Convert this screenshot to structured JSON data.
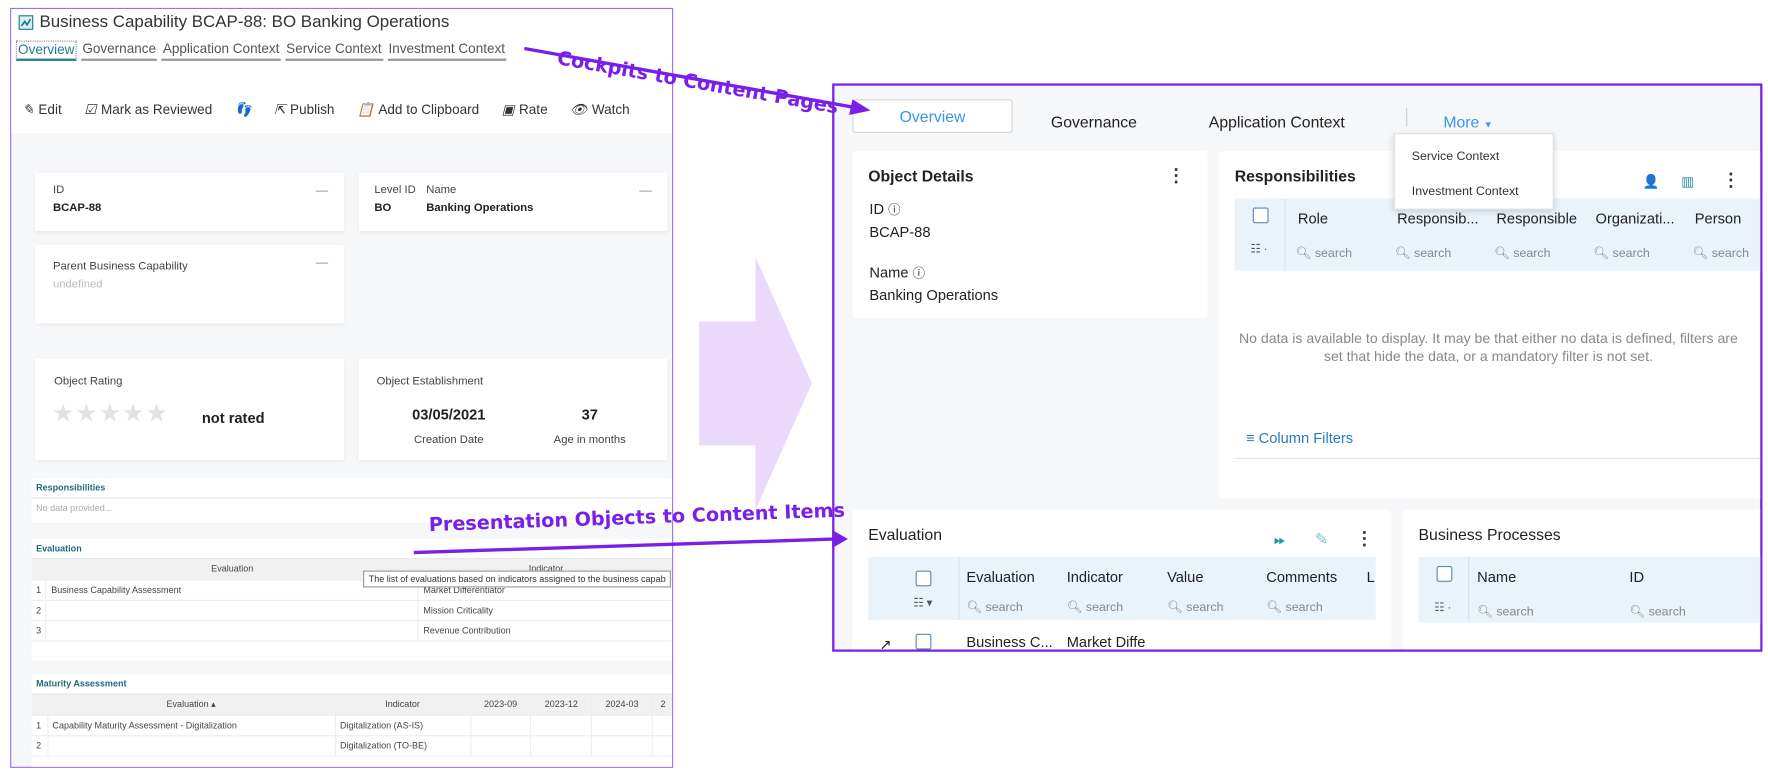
{
  "left": {
    "title": "Business Capability BCAP-88: BO Banking Operations",
    "tabs": [
      "Overview",
      "Governance",
      "Application Context",
      "Service Context",
      "Investment Context"
    ],
    "toolbar": {
      "edit": "Edit",
      "review": "Mark as Reviewed",
      "publish": "Publish",
      "clipboard": "Add to Clipboard",
      "rate": "Rate",
      "watch": "Watch"
    },
    "id_label": "ID",
    "id_value": "BCAP-88",
    "level_label": "Level ID",
    "level_value": "BO",
    "name_label": "Name",
    "name_value": "Banking Operations",
    "parent_label": "Parent Business Capability",
    "parent_value": "undefined",
    "rating_label": "Object Rating",
    "rating_value": "not rated",
    "rating_stars": 0,
    "establishment_label": "Object Establishment",
    "creation_date": "03/05/2021",
    "creation_label": "Creation Date",
    "age": "37",
    "age_label": "Age in months",
    "resp_title": "Responsibilities",
    "resp_empty": "No data provided...",
    "eval_title": "Evaluation",
    "eval_headers": [
      "Evaluation",
      "Indicator"
    ],
    "eval_rows": [
      [
        "1",
        "Business Capability Assessment",
        "Market Differentiator"
      ],
      [
        "2",
        "",
        "Mission Criticality"
      ],
      [
        "3",
        "",
        "Revenue Contribution"
      ]
    ],
    "eval_tooltip": "The list of evaluations based on indicators assigned to the business capab",
    "mat_title": "Maturity Assessment",
    "mat_headers": [
      "Evaluation ▴",
      "Indicator",
      "2023-09",
      "2023-12",
      "2024-03",
      "2"
    ],
    "mat_rows": [
      [
        "1",
        "Capability Maturity Assessment - Digitalization",
        "Digitalization (AS-IS)"
      ],
      [
        "2",
        "",
        "Digitalization (TO-BE)"
      ]
    ]
  },
  "right": {
    "tabs": {
      "overview": "Overview",
      "governance": "Governance",
      "application": "Application Context",
      "more": "More"
    },
    "more_menu": [
      "Service Context",
      "Investment Context"
    ],
    "object_details": {
      "title": "Object Details",
      "id_label": "ID",
      "id_value": "BCAP-88",
      "name_label": "Name",
      "name_value": "Banking Operations"
    },
    "responsibilities": {
      "title": "Responsibilities",
      "columns": [
        "Role",
        "Responsib...",
        "Responsible",
        "Organizati...",
        "Person"
      ],
      "search_placeholder": "search",
      "empty": "No data is available to display. It may be that either no data is defined, filters are set that hide the data, or a mandatory filter is not set.",
      "column_filters": "Column Filters"
    },
    "evaluation": {
      "title": "Evaluation",
      "columns": [
        "Evaluation",
        "Indicator",
        "Value",
        "Comments",
        "L"
      ],
      "search_placeholder": "search",
      "row": [
        "Business C...",
        "Market Diffe"
      ]
    },
    "business_processes": {
      "title": "Business Processes",
      "columns": [
        "Name",
        "ID"
      ],
      "search_placeholder": "search"
    }
  },
  "annotations": {
    "top": "Cockpits to Content Pages",
    "bottom": "Presentation Objects to Content Items"
  },
  "colors": {
    "annotation": "#7a1fe8",
    "accent": "#3b95e6",
    "teal": "#1b7d8a",
    "big_arrow": "#ead9fb"
  }
}
